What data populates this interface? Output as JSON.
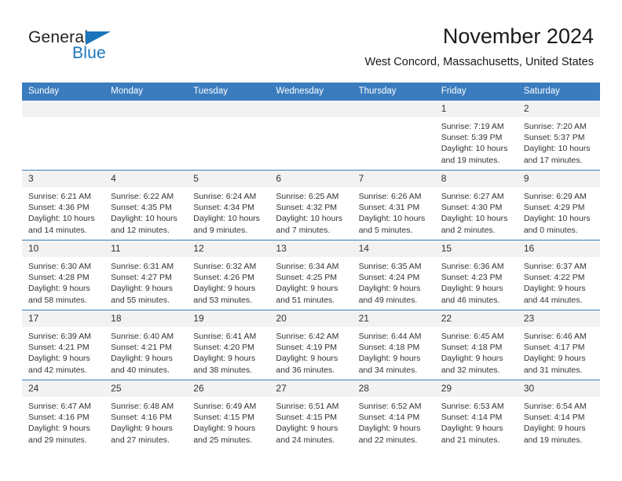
{
  "logo": {
    "text_top": "General",
    "text_bottom": "Blue",
    "triangle_color": "#1b75bb",
    "icon": "triangle-icon"
  },
  "header": {
    "title": "November 2024",
    "subtitle": "West Concord, Massachusetts, United States"
  },
  "theme": {
    "header_blue": "#3a7cbe",
    "daynum_band": "#f2f2f2",
    "text": "#333333"
  },
  "calendar": {
    "weekday_headers": [
      "Sunday",
      "Monday",
      "Tuesday",
      "Wednesday",
      "Thursday",
      "Friday",
      "Saturday"
    ],
    "weeks": [
      [
        {
          "day": "",
          "empty": true
        },
        {
          "day": "",
          "empty": true
        },
        {
          "day": "",
          "empty": true
        },
        {
          "day": "",
          "empty": true
        },
        {
          "day": "",
          "empty": true
        },
        {
          "day": "1",
          "sunrise": "Sunrise: 7:19 AM",
          "sunset": "Sunset: 5:39 PM",
          "daylight": "Daylight: 10 hours and 19 minutes."
        },
        {
          "day": "2",
          "sunrise": "Sunrise: 7:20 AM",
          "sunset": "Sunset: 5:37 PM",
          "daylight": "Daylight: 10 hours and 17 minutes."
        }
      ],
      [
        {
          "day": "3",
          "sunrise": "Sunrise: 6:21 AM",
          "sunset": "Sunset: 4:36 PM",
          "daylight": "Daylight: 10 hours and 14 minutes."
        },
        {
          "day": "4",
          "sunrise": "Sunrise: 6:22 AM",
          "sunset": "Sunset: 4:35 PM",
          "daylight": "Daylight: 10 hours and 12 minutes."
        },
        {
          "day": "5",
          "sunrise": "Sunrise: 6:24 AM",
          "sunset": "Sunset: 4:34 PM",
          "daylight": "Daylight: 10 hours and 9 minutes."
        },
        {
          "day": "6",
          "sunrise": "Sunrise: 6:25 AM",
          "sunset": "Sunset: 4:32 PM",
          "daylight": "Daylight: 10 hours and 7 minutes."
        },
        {
          "day": "7",
          "sunrise": "Sunrise: 6:26 AM",
          "sunset": "Sunset: 4:31 PM",
          "daylight": "Daylight: 10 hours and 5 minutes."
        },
        {
          "day": "8",
          "sunrise": "Sunrise: 6:27 AM",
          "sunset": "Sunset: 4:30 PM",
          "daylight": "Daylight: 10 hours and 2 minutes."
        },
        {
          "day": "9",
          "sunrise": "Sunrise: 6:29 AM",
          "sunset": "Sunset: 4:29 PM",
          "daylight": "Daylight: 10 hours and 0 minutes."
        }
      ],
      [
        {
          "day": "10",
          "sunrise": "Sunrise: 6:30 AM",
          "sunset": "Sunset: 4:28 PM",
          "daylight": "Daylight: 9 hours and 58 minutes."
        },
        {
          "day": "11",
          "sunrise": "Sunrise: 6:31 AM",
          "sunset": "Sunset: 4:27 PM",
          "daylight": "Daylight: 9 hours and 55 minutes."
        },
        {
          "day": "12",
          "sunrise": "Sunrise: 6:32 AM",
          "sunset": "Sunset: 4:26 PM",
          "daylight": "Daylight: 9 hours and 53 minutes."
        },
        {
          "day": "13",
          "sunrise": "Sunrise: 6:34 AM",
          "sunset": "Sunset: 4:25 PM",
          "daylight": "Daylight: 9 hours and 51 minutes."
        },
        {
          "day": "14",
          "sunrise": "Sunrise: 6:35 AM",
          "sunset": "Sunset: 4:24 PM",
          "daylight": "Daylight: 9 hours and 49 minutes."
        },
        {
          "day": "15",
          "sunrise": "Sunrise: 6:36 AM",
          "sunset": "Sunset: 4:23 PM",
          "daylight": "Daylight: 9 hours and 46 minutes."
        },
        {
          "day": "16",
          "sunrise": "Sunrise: 6:37 AM",
          "sunset": "Sunset: 4:22 PM",
          "daylight": "Daylight: 9 hours and 44 minutes."
        }
      ],
      [
        {
          "day": "17",
          "sunrise": "Sunrise: 6:39 AM",
          "sunset": "Sunset: 4:21 PM",
          "daylight": "Daylight: 9 hours and 42 minutes."
        },
        {
          "day": "18",
          "sunrise": "Sunrise: 6:40 AM",
          "sunset": "Sunset: 4:21 PM",
          "daylight": "Daylight: 9 hours and 40 minutes."
        },
        {
          "day": "19",
          "sunrise": "Sunrise: 6:41 AM",
          "sunset": "Sunset: 4:20 PM",
          "daylight": "Daylight: 9 hours and 38 minutes."
        },
        {
          "day": "20",
          "sunrise": "Sunrise: 6:42 AM",
          "sunset": "Sunset: 4:19 PM",
          "daylight": "Daylight: 9 hours and 36 minutes."
        },
        {
          "day": "21",
          "sunrise": "Sunrise: 6:44 AM",
          "sunset": "Sunset: 4:18 PM",
          "daylight": "Daylight: 9 hours and 34 minutes."
        },
        {
          "day": "22",
          "sunrise": "Sunrise: 6:45 AM",
          "sunset": "Sunset: 4:18 PM",
          "daylight": "Daylight: 9 hours and 32 minutes."
        },
        {
          "day": "23",
          "sunrise": "Sunrise: 6:46 AM",
          "sunset": "Sunset: 4:17 PM",
          "daylight": "Daylight: 9 hours and 31 minutes."
        }
      ],
      [
        {
          "day": "24",
          "sunrise": "Sunrise: 6:47 AM",
          "sunset": "Sunset: 4:16 PM",
          "daylight": "Daylight: 9 hours and 29 minutes."
        },
        {
          "day": "25",
          "sunrise": "Sunrise: 6:48 AM",
          "sunset": "Sunset: 4:16 PM",
          "daylight": "Daylight: 9 hours and 27 minutes."
        },
        {
          "day": "26",
          "sunrise": "Sunrise: 6:49 AM",
          "sunset": "Sunset: 4:15 PM",
          "daylight": "Daylight: 9 hours and 25 minutes."
        },
        {
          "day": "27",
          "sunrise": "Sunrise: 6:51 AM",
          "sunset": "Sunset: 4:15 PM",
          "daylight": "Daylight: 9 hours and 24 minutes."
        },
        {
          "day": "28",
          "sunrise": "Sunrise: 6:52 AM",
          "sunset": "Sunset: 4:14 PM",
          "daylight": "Daylight: 9 hours and 22 minutes."
        },
        {
          "day": "29",
          "sunrise": "Sunrise: 6:53 AM",
          "sunset": "Sunset: 4:14 PM",
          "daylight": "Daylight: 9 hours and 21 minutes."
        },
        {
          "day": "30",
          "sunrise": "Sunrise: 6:54 AM",
          "sunset": "Sunset: 4:14 PM",
          "daylight": "Daylight: 9 hours and 19 minutes."
        }
      ]
    ]
  }
}
